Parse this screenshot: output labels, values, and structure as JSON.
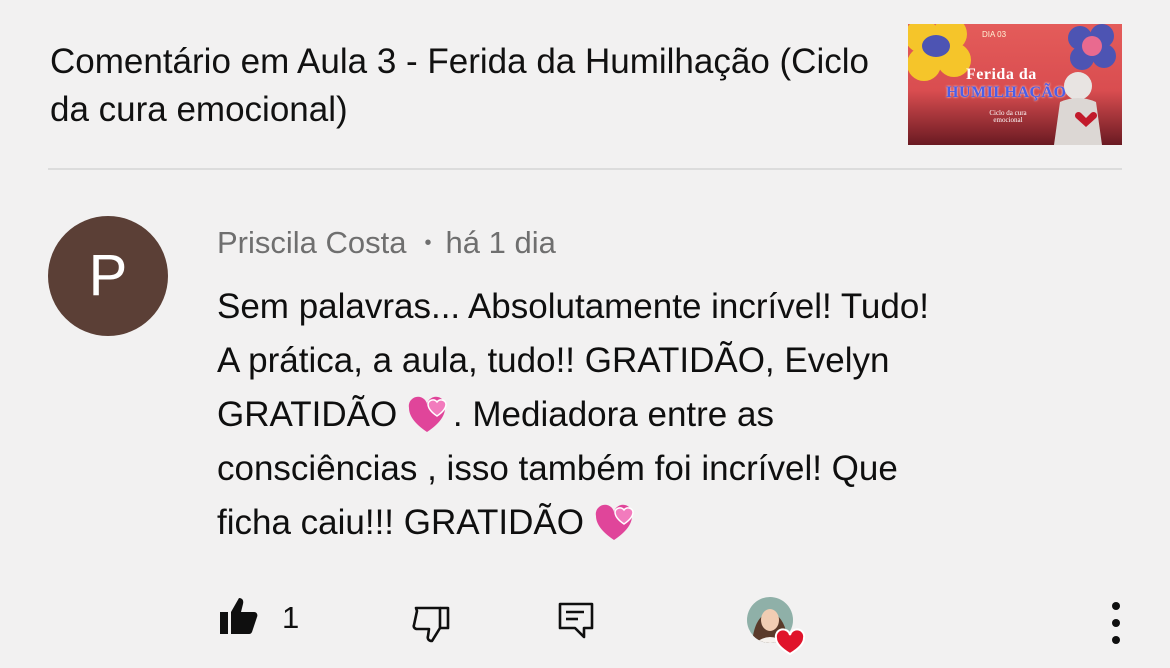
{
  "header": {
    "title": "Comentário em Aula 3 - Ferida da Humilhação (Ciclo da cura emocional)",
    "thumbnail": {
      "day_label": "DIA 03",
      "line1": "Ferida da",
      "line2": "HUMILHAÇÃO",
      "subtitle": "Ciclo da cura emocional"
    }
  },
  "comment": {
    "avatar_letter": "P",
    "author": "Priscila Costa",
    "separator": "•",
    "time": "há 1 dia",
    "text_part1": "Sem palavras... Absolutamente incrível! Tudo!\nA prática, a aula, tudo!! GRATIDÃO,  Evelyn\nGRATIDÃO ",
    "text_part2": ". Mediadora entre as\nconsciências , isso também foi incrível! Que\nficha caiu!!! GRATIDÃO ",
    "emoji": "two-hearts"
  },
  "actions": {
    "like_count": "1",
    "icons": [
      "thumbs-up-icon",
      "thumbs-down-icon",
      "reply-icon",
      "creator-heart-avatar",
      "more-options-icon"
    ]
  },
  "colors": {
    "background": "#f2f1f1",
    "avatar_bg": "#5b3f36",
    "meta_text": "#6f6f6f",
    "heart": "#e0142b"
  }
}
